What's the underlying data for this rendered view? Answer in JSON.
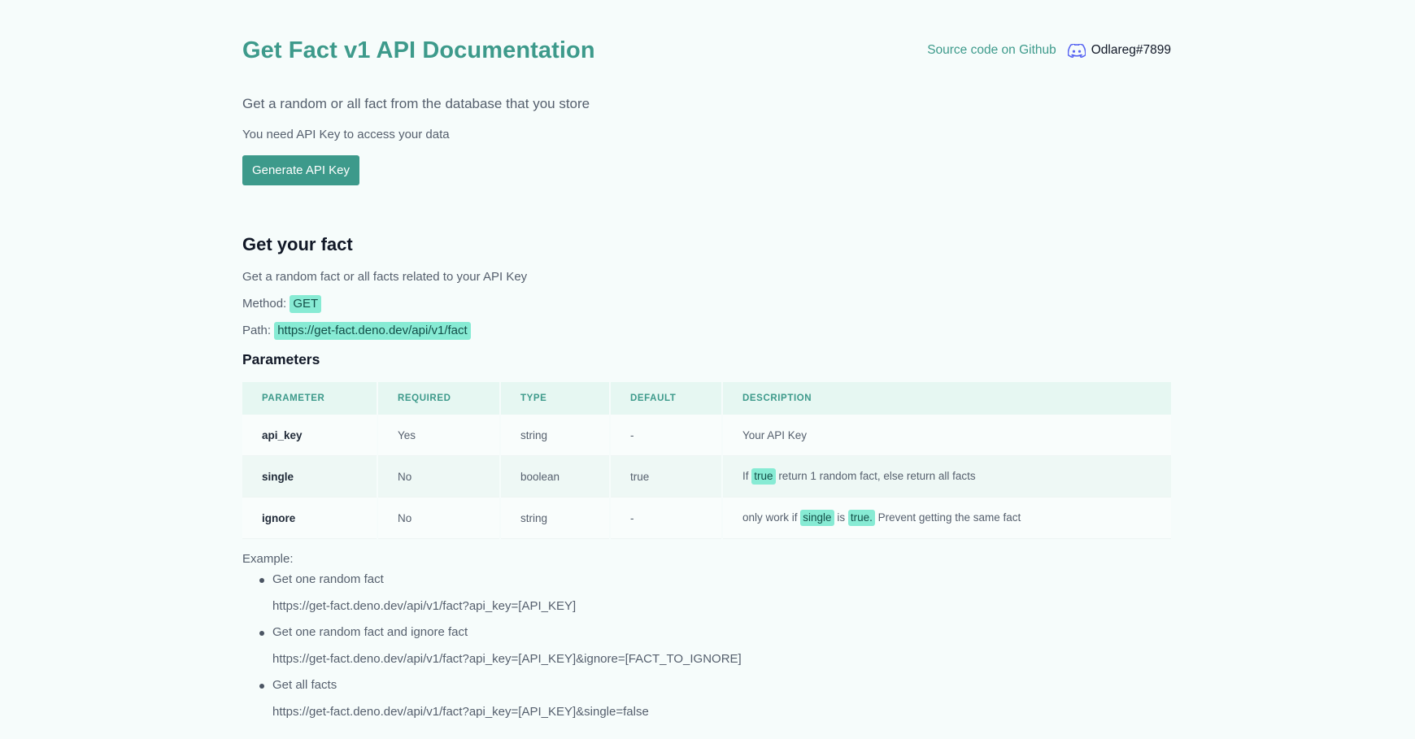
{
  "header": {
    "title": "Get Fact v1 API Documentation",
    "github_link": "Source code on Github",
    "discord_icon": "discord-icon",
    "discord_user": "Odlareg#7899"
  },
  "intro": {
    "lead": "Get a random or all fact from the database that you store",
    "need_key": "You need API Key to access your data",
    "generate_button": "Generate API Key"
  },
  "section": {
    "title": "Get your fact",
    "subtitle": "Get a random fact or all facts related to your API Key",
    "method_label": "Method:",
    "method_value": "GET",
    "path_label": "Path:",
    "path_value": "https://get-fact.deno.dev/api/v1/fact",
    "params_title": "Parameters"
  },
  "table": {
    "headers": [
      "PARAMETER",
      "REQUIRED",
      "TYPE",
      "DEFAULT",
      "DESCRIPTION"
    ],
    "rows": [
      {
        "parameter": "api_key",
        "required": "Yes",
        "type": "string",
        "default": "-",
        "description": "Your API Key"
      },
      {
        "parameter": "single",
        "required": "No",
        "type": "boolean",
        "default": "true",
        "desc_pre": "If",
        "desc_tag": "true",
        "desc_post": "return 1 random fact, else return all facts"
      },
      {
        "parameter": "ignore",
        "required": "No",
        "type": "string",
        "default": "-",
        "desc_pre": "only work if",
        "desc_tag1": "single",
        "desc_mid": "is",
        "desc_tag2": "true.",
        "desc_post": "Prevent getting the same fact"
      }
    ]
  },
  "examples": {
    "label": "Example:",
    "items": [
      {
        "title": "Get one random fact",
        "url": "https://get-fact.deno.dev/api/v1/fact?api_key=[API_KEY]"
      },
      {
        "title": "Get one random fact and ignore fact",
        "url": "https://get-fact.deno.dev/api/v1/fact?api_key=[API_KEY]&ignore=[FACT_TO_IGNORE]"
      },
      {
        "title": "Get all facts",
        "url": "https://get-fact.deno.dev/api/v1/fact?api_key=[API_KEY]&single=false"
      }
    ]
  }
}
